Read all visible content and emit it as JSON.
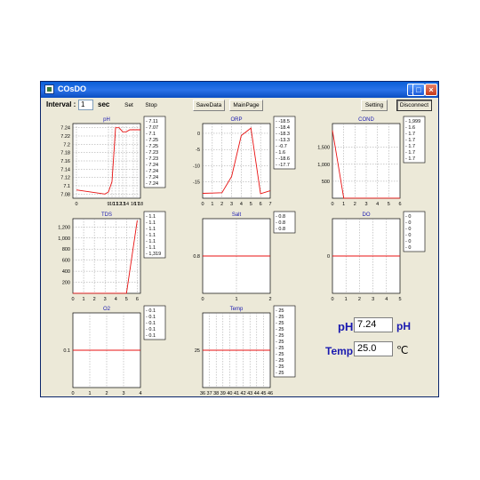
{
  "window": {
    "title": "COsDO"
  },
  "toolbar": {
    "interval_label": "Interval :",
    "interval_value": "1",
    "unit": "sec",
    "set": "Set",
    "stop": "Stop",
    "save_data": "SaveData",
    "main_page": "MainPage",
    "setting": "Setting",
    "disconnect": "Disconnect"
  },
  "readout": {
    "ph_label": "pH",
    "ph_value": "7.24",
    "ph_unit": "pH",
    "temp_label": "Temp",
    "temp_value": "25.0",
    "temp_unit": "℃"
  },
  "colors": {
    "line": "#e81010",
    "title": "#1a1ab0",
    "grid": "#9a9a9a",
    "plot_bg": "#ffffff"
  },
  "chart_data": [
    {
      "type": "line",
      "title": "pH",
      "x": [
        0,
        8,
        9,
        10,
        11,
        12,
        13,
        14,
        15,
        16,
        17,
        18
      ],
      "y": [
        7.09,
        7.08,
        7.085,
        7.11,
        7.24,
        7.24,
        7.23,
        7.23,
        7.235,
        7.235,
        7.235,
        7.235
      ],
      "xticks": [
        "0",
        "9",
        "10",
        "11",
        "12",
        "13",
        "14",
        "16",
        "17",
        "18"
      ],
      "xticks_v": [
        0,
        9,
        10,
        11,
        12,
        13,
        14,
        16,
        17,
        18
      ],
      "yticks": [
        "7.24",
        "7.22",
        "7.2",
        "7.18",
        "7.16",
        "7.14",
        "7.12",
        "7.1",
        "7.08"
      ],
      "yticks_v": [
        7.24,
        7.22,
        7.2,
        7.18,
        7.16,
        7.14,
        7.12,
        7.1,
        7.08
      ],
      "xlim": [
        -1,
        18
      ],
      "ylim": [
        7.07,
        7.25
      ],
      "legend": [
        "7.11",
        "7.07",
        "7.1",
        "7.25",
        "7.25",
        "7.23",
        "7.23",
        "7.24",
        "7.24",
        "7.24",
        "7.24"
      ],
      "grid": true
    },
    {
      "type": "line",
      "title": "ORP",
      "x": [
        0,
        1,
        2,
        3,
        4,
        5,
        6,
        7
      ],
      "y": [
        -18.5,
        -18.4,
        -18.3,
        -13.3,
        -0.7,
        1.6,
        -18.6,
        -17.7
      ],
      "xticks": [
        "0",
        "1",
        "2",
        "3",
        "4",
        "5",
        "6",
        "7"
      ],
      "xticks_v": [
        0,
        1,
        2,
        3,
        4,
        5,
        6,
        7
      ],
      "yticks": [
        "0",
        "-5",
        "-10",
        "-15"
      ],
      "yticks_v": [
        0,
        -5,
        -10,
        -15
      ],
      "xlim": [
        0,
        7
      ],
      "ylim": [
        -20,
        3
      ],
      "legend": [
        "-18.5",
        "-18.4",
        "-18.3",
        "-13.3",
        "-0.7",
        "1.6",
        "-18.6",
        "-17.7"
      ],
      "grid": true
    },
    {
      "type": "line",
      "title": "COND",
      "x": [
        0,
        1,
        2,
        3,
        4,
        5,
        6
      ],
      "y": [
        1999,
        1.7,
        1.7,
        1.7,
        1.7,
        1.7,
        1.7
      ],
      "xticks": [
        "0",
        "1",
        "2",
        "3",
        "4",
        "5",
        "6"
      ],
      "xticks_v": [
        0,
        1,
        2,
        3,
        4,
        5,
        6
      ],
      "yticks": [
        "1,500",
        "1,000",
        "500"
      ],
      "yticks_v": [
        1500,
        1000,
        500
      ],
      "xlim": [
        0,
        6
      ],
      "ylim": [
        0,
        2200
      ],
      "legend": [
        "1,999",
        "1.6",
        "1.7",
        "1.7",
        "1.7",
        "1.7",
        "1.7"
      ],
      "grid": true
    },
    {
      "type": "line",
      "title": "TDS",
      "x": [
        0,
        1,
        2,
        3,
        4,
        5,
        6
      ],
      "y": [
        1.1,
        1.1,
        1.1,
        1.1,
        1.1,
        1.1,
        1319
      ],
      "xticks": [
        "0",
        "1",
        "2",
        "3",
        "4",
        "5",
        "6"
      ],
      "xticks_v": [
        0,
        1,
        2,
        3,
        4,
        5,
        6
      ],
      "yticks": [
        "1,200",
        "1,000",
        "800",
        "600",
        "400",
        "200"
      ],
      "yticks_v": [
        1200,
        1000,
        800,
        600,
        400,
        200
      ],
      "xlim": [
        0,
        6.3
      ],
      "ylim": [
        0,
        1350
      ],
      "legend": [
        "1.1",
        "1.1",
        "1.1",
        "1.1",
        "1.1",
        "1.1",
        "1,319"
      ],
      "grid": true
    },
    {
      "type": "line",
      "title": "Salt",
      "x": [
        0,
        1,
        2
      ],
      "y": [
        0.8,
        0.8,
        0.8
      ],
      "xticks": [
        "0",
        "1",
        "2"
      ],
      "xticks_v": [
        0,
        1,
        2
      ],
      "yticks": [
        "0.8"
      ],
      "yticks_v": [
        0.8
      ],
      "xlim": [
        0,
        2
      ],
      "ylim": [
        0.3,
        1.3
      ],
      "legend": [
        "0.8",
        "0.8",
        "0.8"
      ],
      "grid": true
    },
    {
      "type": "line",
      "title": "DO",
      "x": [
        0,
        1,
        2,
        3,
        4,
        5
      ],
      "y": [
        0,
        0,
        0,
        0,
        0,
        0
      ],
      "xticks": [
        "0",
        "1",
        "2",
        "3",
        "4",
        "5"
      ],
      "xticks_v": [
        0,
        1,
        2,
        3,
        4,
        5
      ],
      "yticks": [
        "0"
      ],
      "yticks_v": [
        0
      ],
      "xlim": [
        0,
        5
      ],
      "ylim": [
        -0.5,
        0.5
      ],
      "legend": [
        "0",
        "0",
        "0",
        "0",
        "0",
        "0"
      ],
      "grid": true
    },
    {
      "type": "line",
      "title": "O2",
      "x": [
        0,
        1,
        2,
        3,
        4
      ],
      "y": [
        0.1,
        0.1,
        0.1,
        0.1,
        0.1
      ],
      "xticks": [
        "0",
        "1",
        "2",
        "3",
        "4"
      ],
      "xticks_v": [
        0,
        1,
        2,
        3,
        4
      ],
      "yticks": [
        "0.1"
      ],
      "yticks_v": [
        0.1
      ],
      "xlim": [
        0,
        4
      ],
      "ylim": [
        -0.4,
        0.6
      ],
      "legend": [
        "0.1",
        "0.1",
        "0.1",
        "0.1",
        "0.1"
      ],
      "grid": true
    },
    {
      "type": "line",
      "title": "Temp",
      "x": [
        36,
        37,
        38,
        39,
        40,
        41,
        42,
        43,
        44,
        45,
        46
      ],
      "y": [
        25,
        25,
        25,
        25,
        25,
        25,
        25,
        25,
        25,
        25,
        25
      ],
      "xticks": [
        "36",
        "37",
        "38",
        "39",
        "40",
        "41",
        "42",
        "43",
        "44",
        "45",
        "46"
      ],
      "xticks_v": [
        36,
        37,
        38,
        39,
        40,
        41,
        42,
        43,
        44,
        45,
        46
      ],
      "yticks": [
        "25"
      ],
      "yticks_v": [
        25
      ],
      "xlim": [
        36,
        46
      ],
      "ylim": [
        24.5,
        25.5
      ],
      "legend": [
        "25",
        "25",
        "25",
        "25",
        "25",
        "25",
        "25",
        "25",
        "25",
        "25",
        "25"
      ],
      "grid": true
    }
  ]
}
